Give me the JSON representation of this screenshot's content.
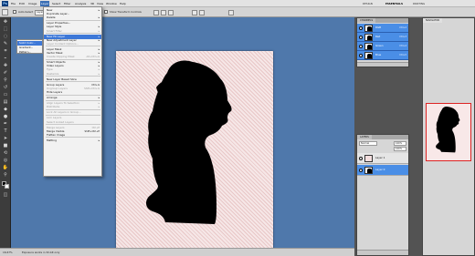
{
  "app": {
    "logo": "Ps"
  },
  "menubar": {
    "items": [
      "File",
      "Edit",
      "Image",
      "Layer",
      "Select",
      "Filter",
      "Analysis",
      "3D",
      "View",
      "Window",
      "Help"
    ],
    "active": "Layer",
    "workspaces": [
      "DESIGN",
      "ESSENTIALS",
      "PAINTING"
    ],
    "active_workspace": "ESSENTIALS"
  },
  "optionsbar": {
    "auto_select_label": "Auto-Select",
    "layer_option": "Layer",
    "transform_label": "Show Transform Controls"
  },
  "layer_menu": {
    "items": [
      {
        "label": "New",
        "submenu": true,
        "disabled": false
      },
      {
        "label": "Duplicate Layer...",
        "disabled": false
      },
      {
        "label": "Delete",
        "submenu": true,
        "disabled": false
      },
      {
        "sep": true
      },
      {
        "label": "Layer Properties...",
        "disabled": false
      },
      {
        "label": "Layer Style",
        "submenu": true,
        "disabled": false
      },
      {
        "label": "Smart Filter",
        "submenu": true,
        "disabled": true
      },
      {
        "sep": true
      },
      {
        "label": "New Fill Layer",
        "submenu": true,
        "disabled": false,
        "highlight": true
      },
      {
        "label": "New Adjustment Layer",
        "submenu": true,
        "disabled": false
      },
      {
        "label": "Layer Content Options...",
        "disabled": true
      },
      {
        "sep": true
      },
      {
        "label": "Layer Mask",
        "submenu": true,
        "disabled": false
      },
      {
        "label": "Vector Mask",
        "submenu": true,
        "disabled": false
      },
      {
        "label": "Create Clipping Mask",
        "shortcut": "Alt+Ctrl+G",
        "disabled": true
      },
      {
        "sep": true
      },
      {
        "label": "Smart Objects",
        "submenu": true,
        "disabled": false
      },
      {
        "label": "Video Layers",
        "submenu": true,
        "disabled": false
      },
      {
        "label": "Type",
        "submenu": true,
        "disabled": true
      },
      {
        "label": "Rasterize",
        "submenu": true,
        "disabled": true
      },
      {
        "sep": true
      },
      {
        "label": "New Layer Based Slice",
        "disabled": false
      },
      {
        "sep": true
      },
      {
        "label": "Group Layers",
        "shortcut": "Ctrl+G",
        "disabled": false
      },
      {
        "label": "Ungroup Layers",
        "shortcut": "Shift+Ctrl+G",
        "disabled": true
      },
      {
        "label": "Hide Layers",
        "disabled": false
      },
      {
        "sep": true
      },
      {
        "label": "Arrange",
        "submenu": true,
        "disabled": false
      },
      {
        "sep": true
      },
      {
        "label": "Align Layers To Selection",
        "submenu": true,
        "disabled": true
      },
      {
        "label": "Distribute",
        "submenu": true,
        "disabled": true
      },
      {
        "sep": true
      },
      {
        "label": "Lock All Layers in Group...",
        "disabled": true
      },
      {
        "sep": true
      },
      {
        "label": "Link Layers",
        "disabled": true
      },
      {
        "label": "Select Linked Layers",
        "disabled": true
      },
      {
        "sep": true
      },
      {
        "label": "Merge Layers",
        "shortcut": "Ctrl+E",
        "disabled": true
      },
      {
        "label": "Merge Visible",
        "shortcut": "Shift+Ctrl+E",
        "disabled": false
      },
      {
        "label": "Flatten Image",
        "disabled": false
      },
      {
        "sep": true
      },
      {
        "label": "Matting",
        "submenu": true,
        "disabled": false
      }
    ]
  },
  "submenu": {
    "items": [
      "Solid Color...",
      "Gradient...",
      "Pattern..."
    ],
    "highlighted": "Solid Color..."
  },
  "channels": {
    "tab": "CHANNELS",
    "rows": [
      {
        "name": "RGB",
        "shortcut": "Ctrl+2"
      },
      {
        "name": "Red",
        "shortcut": "Ctrl+3"
      },
      {
        "name": "Green",
        "shortcut": "Ctrl+4"
      },
      {
        "name": "Blue",
        "shortcut": "Ctrl+5"
      }
    ]
  },
  "navigator": {
    "tab": "NAVIGATOR"
  },
  "layers": {
    "tab": "LAYERS",
    "blend_mode": "Normal",
    "opacity": "100%",
    "fill": "100%",
    "rows": [
      {
        "name": "Layer 1",
        "selected": false
      },
      {
        "name": "Layer 0",
        "selected": true
      }
    ]
  },
  "status": {
    "zoom": "16.67%",
    "doc": "Exposure works in 32-bit only"
  },
  "colors": {
    "accent": "#3d78d8",
    "doc_bg": "#4f78ab",
    "canvas": "#f6e7e7",
    "silhouette": "#000000"
  }
}
